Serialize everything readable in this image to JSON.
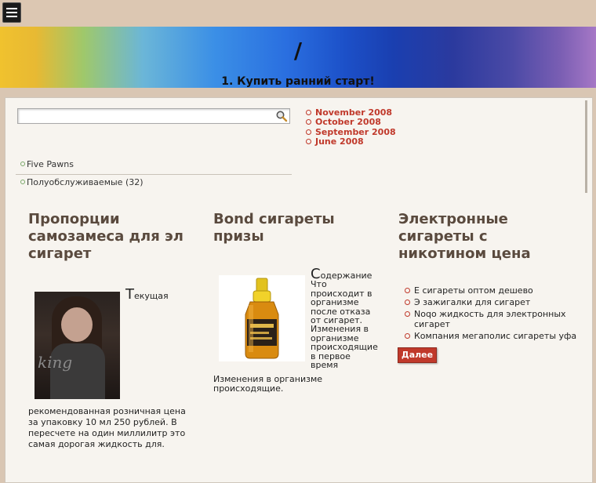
{
  "menu": {
    "icon": "hamburger-icon"
  },
  "banner": {
    "title": "/",
    "subtitle": "1. Купить ранний старт!"
  },
  "search": {
    "value": "",
    "placeholder": "",
    "icon": "search-icon"
  },
  "archives": [
    "November 2008",
    "October 2008",
    "September 2008",
    "June 2008"
  ],
  "categories": [
    "Five Pawns",
    "Полуобслуживаемые (32)"
  ],
  "posts": [
    {
      "title": "Пропорции самозамеса для эл сигарет",
      "image_text": "king",
      "drop_cap": "Т",
      "lead": "екущая",
      "body": "рекомендованная розничная цена за упаковку 10 мл 250 рублей. В пересчете на один миллилитр это самая дорогая жидкость для."
    },
    {
      "title": "Bond сигареты призы",
      "drop_cap": "С",
      "lead": "одержание",
      "side_text": "Что происходит в организме после отказа от сигарет. Изменения в организме происходящие в первое время",
      "body": "Изменения в организме происходящие."
    },
    {
      "title": "Электронные сигареты с никотином цена",
      "links": [
        "Е сигареты оптом дешево",
        "Э зажигалки для сигарет",
        "Noqo жидкость для электронных сигарет",
        "Компания мегаполис сигареты уфа"
      ],
      "button": "Далее"
    }
  ],
  "colors": {
    "accent": "#c0392b",
    "title": "#5a4a3e"
  }
}
